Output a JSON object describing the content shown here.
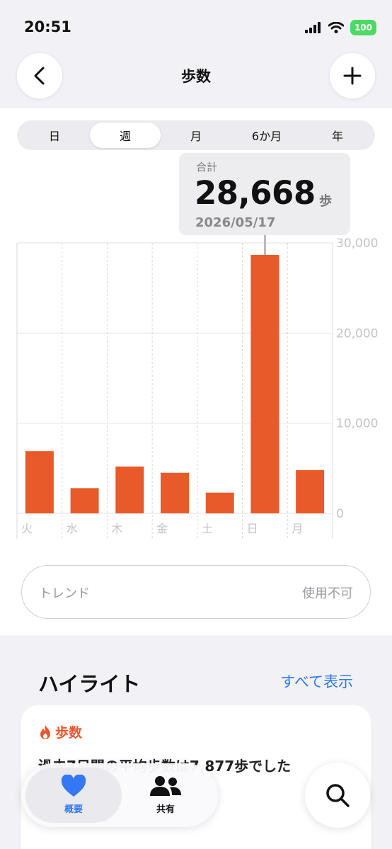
{
  "status_bar": {
    "time": "20:51",
    "battery": "100"
  },
  "header": {
    "title": "歩数"
  },
  "segments": [
    "日",
    "週",
    "月",
    "6か月",
    "年"
  ],
  "active_segment": "週",
  "tooltip": {
    "label": "合計",
    "value": "28,668",
    "unit": "歩",
    "date": "2026/05/17"
  },
  "chart_data": {
    "type": "bar",
    "categories": [
      "火",
      "水",
      "木",
      "金",
      "土",
      "日",
      "月"
    ],
    "values": [
      6900,
      2800,
      5200,
      4500,
      2300,
      28668,
      4800
    ],
    "y_ticks": [
      "30,000",
      "20,000",
      "10,000",
      "0"
    ],
    "ylim": [
      0,
      30000
    ],
    "selected_index": 5,
    "bar_color": "#e95a2b",
    "grid": true
  },
  "trend": {
    "label": "トレンド",
    "status": "使用不可"
  },
  "highlights": {
    "title": "ハイライト",
    "show_all": "すべて表示",
    "card_title": "歩数",
    "card_text": "過去7日間の平均歩数は7,877歩でした"
  },
  "tabbar": {
    "summary": "概要",
    "sharing": "共有"
  },
  "colors": {
    "accent": "#3478f6",
    "steps": "#e8562c"
  }
}
